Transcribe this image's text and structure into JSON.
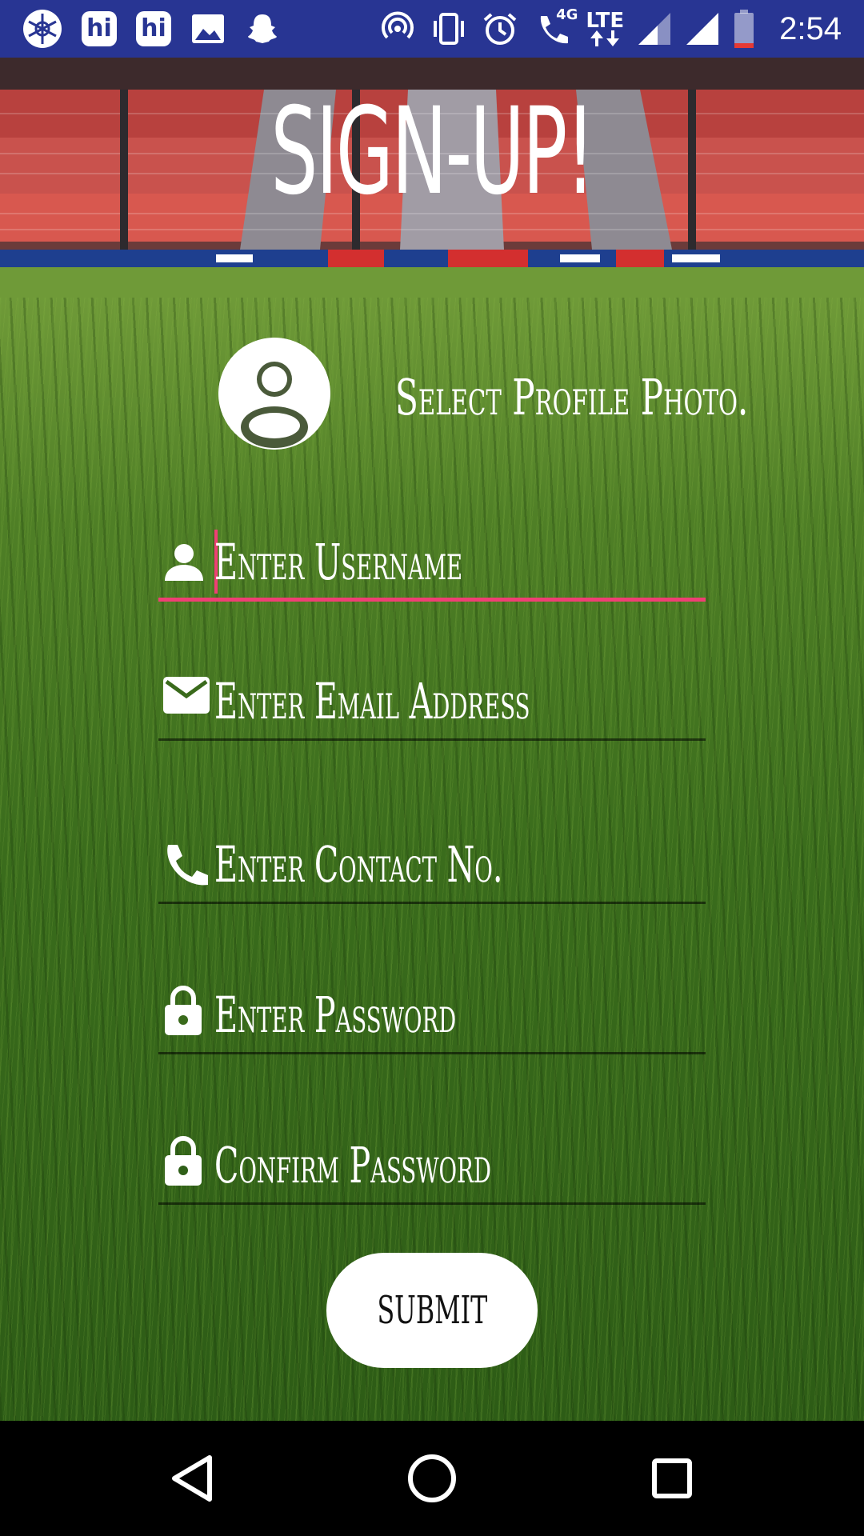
{
  "status_bar": {
    "time": "2:54",
    "left_icons": [
      "pinwheel-app-icon",
      "hi-app-icon",
      "hi-app-icon",
      "gallery-icon",
      "snapchat-icon"
    ],
    "hi_label": "hi",
    "network_label": "4G",
    "lte_label": "LTE",
    "right_icons": [
      "hotspot-icon",
      "vibrate-icon",
      "alarm-icon",
      "wifi-call-icon",
      "lte-icon",
      "signal-icon",
      "signal-icon",
      "battery-low-icon"
    ]
  },
  "header": {
    "title": "SIGN-UP!"
  },
  "profile": {
    "select_label": "Select Profile Photo."
  },
  "form": {
    "fields": [
      {
        "icon": "person-icon",
        "placeholder": "Enter Username",
        "active": true
      },
      {
        "icon": "email-icon",
        "placeholder": "Enter Email Address",
        "active": false
      },
      {
        "icon": "phone-icon",
        "placeholder": "Enter Contact No.",
        "active": false
      },
      {
        "icon": "lock-icon",
        "placeholder": "Enter Password",
        "active": false
      },
      {
        "icon": "lock-icon",
        "placeholder": "Confirm Password",
        "active": false
      }
    ],
    "submit_label": "SUBMIT"
  },
  "nav_bar": {
    "buttons": [
      "back-icon",
      "home-icon",
      "recents-icon"
    ]
  },
  "colors": {
    "status_bar": "#283593",
    "accent": "#ef3f74",
    "text": "#ffffff",
    "button_bg": "#ffffff"
  }
}
